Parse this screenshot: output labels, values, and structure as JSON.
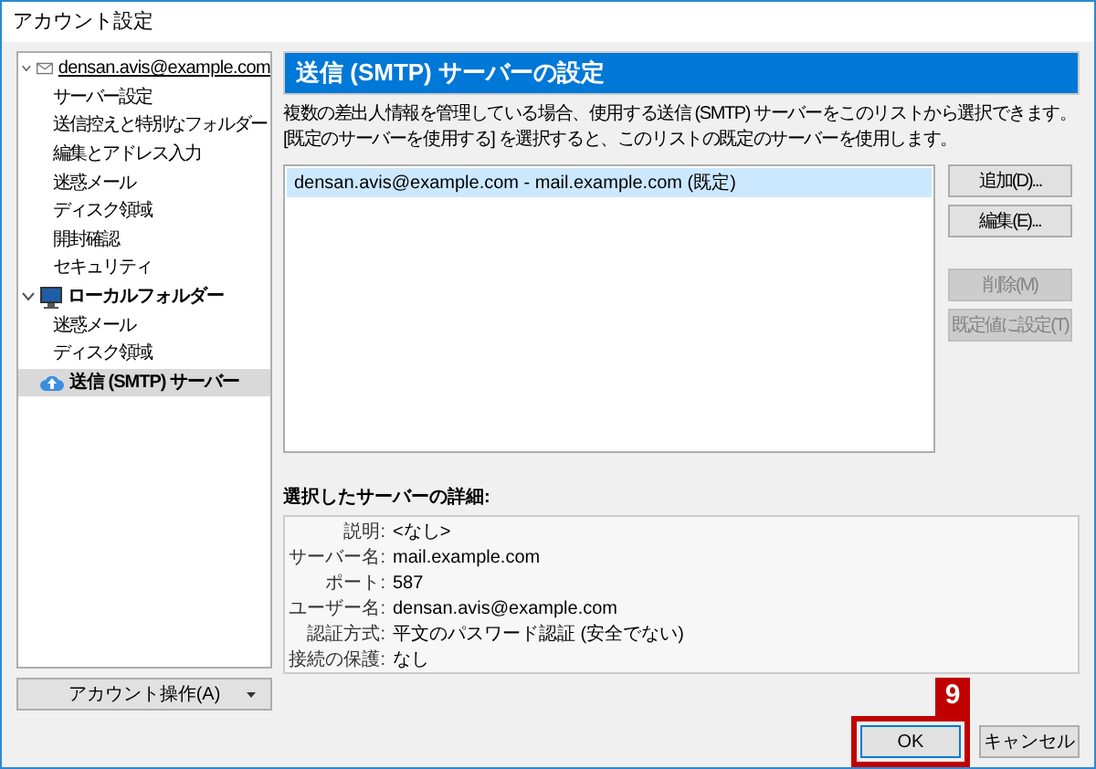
{
  "window": {
    "title": "アカウント設定"
  },
  "sidebar": {
    "items": [
      {
        "label": "densan.avis@example.com",
        "kind": "account",
        "expanded": true,
        "selected": false,
        "children": [
          {
            "label": "サーバー設定",
            "selected": false
          },
          {
            "label": "送信控えと特別なフォルダー",
            "selected": false
          },
          {
            "label": "編集とアドレス入力",
            "selected": false
          },
          {
            "label": "迷惑メール",
            "selected": false
          },
          {
            "label": "ディスク領域",
            "selected": false
          },
          {
            "label": "開封確認",
            "selected": false
          },
          {
            "label": "セキュリティ",
            "selected": false
          }
        ]
      },
      {
        "label": "ローカルフォルダー",
        "kind": "local",
        "expanded": true,
        "selected": false,
        "children": [
          {
            "label": "迷惑メール",
            "selected": false
          },
          {
            "label": "ディスク領域",
            "selected": false
          }
        ]
      },
      {
        "label": "送信 (SMTP) サーバー",
        "kind": "smtp",
        "selected": true
      }
    ],
    "account_actions": "アカウント操作(A)"
  },
  "panel": {
    "title": "送信 (SMTP) サーバーの設定",
    "description": "複数の差出人情報を管理している場合、使用する送信 (SMTP) サーバーをこのリストから選択できます。[既定のサーバーを使用する] を選択すると、このリストの既定のサーバーを使用します。",
    "servers": [
      {
        "label": "densan.avis@example.com - mail.example.com (既定)",
        "selected": true
      }
    ],
    "buttons": [
      {
        "label": "追加(D)...",
        "disabled": false
      },
      {
        "label": "編集(E)...",
        "disabled": false
      },
      {
        "label": "削除(M)",
        "disabled": true
      },
      {
        "label": "既定値に設定(T)",
        "disabled": true
      }
    ],
    "details_title": "選択したサーバーの詳細:",
    "details": [
      {
        "label": "説明:",
        "value": "<なし>"
      },
      {
        "label": "サーバー名:",
        "value": "mail.example.com"
      },
      {
        "label": "ポート:",
        "value": "587"
      },
      {
        "label": "ユーザー名:",
        "value": "densan.avis@example.com"
      },
      {
        "label": "認証方式:",
        "value": "平文のパスワード認証 (安全でない)"
      },
      {
        "label": "接続の保護:",
        "value": "なし"
      }
    ]
  },
  "footer": {
    "buttons": [
      {
        "label": "OK",
        "highlighted": true
      },
      {
        "label": "キャンセル",
        "highlighted": false
      }
    ],
    "callout": "9"
  }
}
